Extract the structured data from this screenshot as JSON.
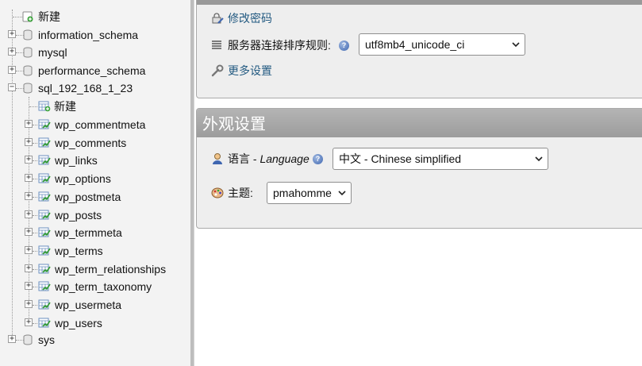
{
  "nav": {
    "new_label": "新建",
    "databases": [
      {
        "name": "information_schema"
      },
      {
        "name": "mysql"
      },
      {
        "name": "performance_schema"
      },
      {
        "name": "sql_192_168_1_23",
        "expanded": true
      }
    ],
    "sub_new_label": "新建",
    "tables": [
      "wp_commentmeta",
      "wp_comments",
      "wp_links",
      "wp_options",
      "wp_postmeta",
      "wp_posts",
      "wp_termmeta",
      "wp_terms",
      "wp_term_relationships",
      "wp_term_taxonomy",
      "wp_usermeta",
      "wp_users"
    ],
    "last_database": "sys",
    "expand_symbol": "+",
    "collapse_symbol": "−"
  },
  "general": {
    "change_password_label": "修改密码",
    "collation_label": "服务器连接排序规则:",
    "collation_value": "utf8mb4_unicode_ci",
    "more_settings_label": "更多设置",
    "help_symbol": "?"
  },
  "appearance": {
    "title": "外观设置",
    "language_label": "语言 - ",
    "language_label_en": "Language",
    "language_value": "中文 - Chinese simplified",
    "theme_label": "主题:",
    "theme_value": "pmahomme"
  },
  "colors": {
    "link": "#235a81",
    "header_bg": "#a6a6a6",
    "panel_bg": "#eeeeee",
    "nav_bg": "#f3f3f3"
  },
  "icons": {
    "database": "database-icon",
    "table": "table-icon",
    "new": "new-item-icon",
    "password": "password-icon",
    "collation": "list-icon",
    "more_settings": "wrench-icon",
    "language": "language-icon",
    "theme": "palette-icon",
    "help": "help-icon"
  }
}
